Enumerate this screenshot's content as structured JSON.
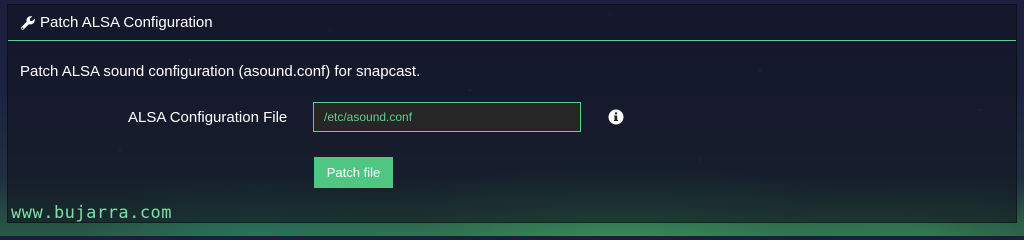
{
  "panel": {
    "title": "Patch ALSA Configuration",
    "title_icon": "wrench-icon",
    "description": "Patch ALSA sound configuration (asound.conf) for snapcast."
  },
  "form": {
    "config_file_label": "ALSA Configuration File",
    "config_file_value": "/etc/asound.conf",
    "info_icon": "info-circle-icon",
    "submit_label": "Patch file"
  },
  "watermark": "www.bujarra.com",
  "colors": {
    "accent": "#5fcf8f",
    "button": "#4fc783",
    "input_bg": "#262626"
  }
}
